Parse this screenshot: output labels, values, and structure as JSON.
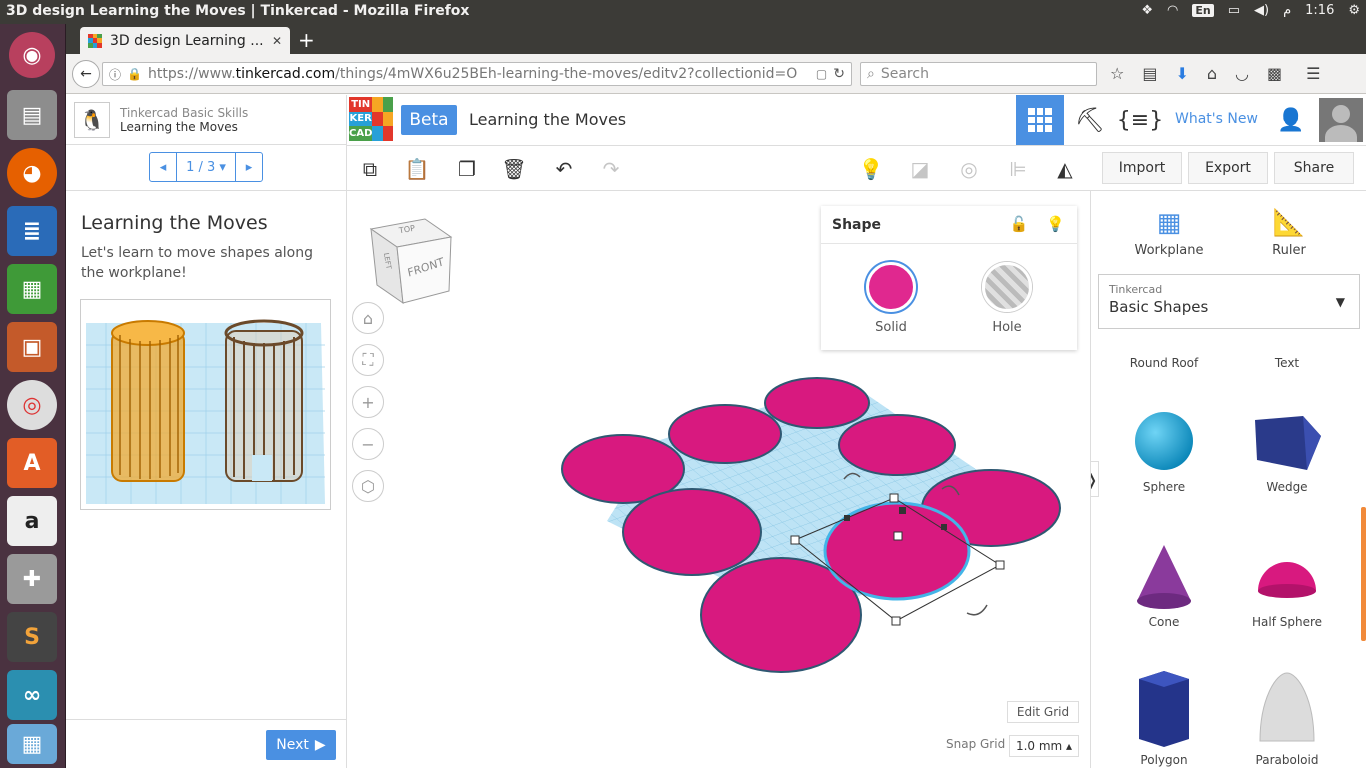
{
  "os": {
    "window_title": "3D design Learning the Moves | Tinkercad - Mozilla Firefox",
    "lang_indicator": "En",
    "clock": "1:16",
    "ampm": "م"
  },
  "browser": {
    "tab_title": "3D design Learning ...",
    "url_prefix": "https://www.",
    "url_domain": "tinkercad.com",
    "url_path": "/things/4mWX6u25BEh-learning-the-moves/editv2?collectionid=O",
    "search_placeholder": "Search"
  },
  "lesson": {
    "course": "Tinkercad Basic Skills",
    "lesson_name": "Learning the Moves",
    "page": "1 / 3",
    "title": "Learning the Moves",
    "description": "Let's learn to move shapes along the workplane!",
    "next_label": "Next"
  },
  "header": {
    "logo_letters": [
      "TIN",
      "KER",
      "CAD"
    ],
    "beta_label": "Beta",
    "design_title": "Learning the Moves",
    "whats_new": "What's New"
  },
  "toolbar": {
    "import": "Import",
    "export": "Export",
    "share": "Share"
  },
  "viewcube": {
    "top": "TOP",
    "front": "FRONT",
    "left": "LEFT"
  },
  "shape_panel": {
    "title": "Shape",
    "solid": "Solid",
    "hole": "Hole",
    "solid_color": "#e0288f"
  },
  "grid": {
    "edit_grid": "Edit Grid",
    "snap_grid_label": "Snap Grid",
    "snap_value": "1.0 mm"
  },
  "library": {
    "workplane": "Workplane",
    "ruler": "Ruler",
    "category_small": "Tinkercad",
    "category": "Basic Shapes",
    "items": [
      "Round Roof",
      "Text",
      "Sphere",
      "Wedge",
      "Cone",
      "Half Sphere",
      "Polygon",
      "Paraboloid"
    ]
  },
  "colors": {
    "accent": "#4a90e2",
    "magenta": "#d8197f",
    "grid": "#bde3f5"
  }
}
